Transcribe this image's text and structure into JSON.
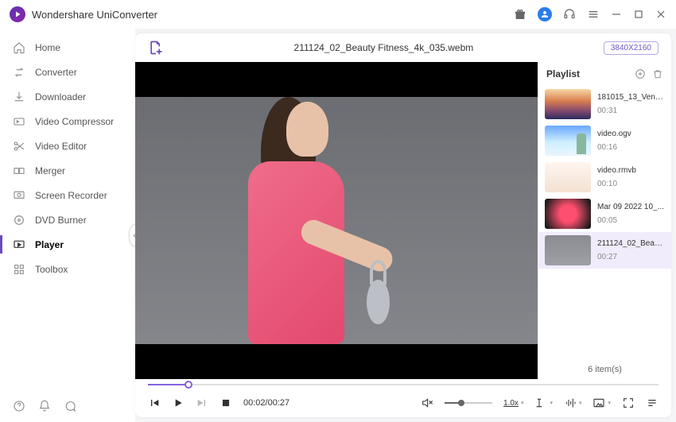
{
  "app": {
    "title": "Wondershare UniConverter"
  },
  "sidebar": {
    "items": [
      {
        "label": "Home"
      },
      {
        "label": "Converter"
      },
      {
        "label": "Downloader"
      },
      {
        "label": "Video Compressor"
      },
      {
        "label": "Video Editor"
      },
      {
        "label": "Merger"
      },
      {
        "label": "Screen Recorder"
      },
      {
        "label": "DVD Burner"
      },
      {
        "label": "Player"
      },
      {
        "label": "Toolbox"
      }
    ]
  },
  "player": {
    "current_title": "211124_02_Beauty Fitness_4k_035.webm",
    "resolution": "3840X2160",
    "time": "00:02/00:27",
    "speed": "1.0x",
    "progress_pct": 8,
    "volume_pct": 35
  },
  "playlist": {
    "title": "Playlist",
    "footer": "6 item(s)",
    "items": [
      {
        "name": "181015_13_Venic...",
        "duration": "00:31",
        "thumb_css": "linear-gradient(180deg,#f7d9a5 0%,#d97d4f 40%,#8a4d6e 70%,#2b2b60 100%)"
      },
      {
        "name": "video.ogv",
        "duration": "00:16",
        "thumb_css": "linear-gradient(180deg,#6aa8ff 0%,#cfefff 55%,#e9f5ff 100%)"
      },
      {
        "name": "video.rmvb",
        "duration": "00:10",
        "thumb_css": "linear-gradient(180deg,#fff6f0 0%,#f3e1d2 100%)"
      },
      {
        "name": "Mar 09 2022 10_...",
        "duration": "00:05",
        "thumb_css": "radial-gradient(circle at 50% 50%, #ff4f6e 0%, #ff4f6e 30%, #1a1a1a 90%)"
      },
      {
        "name": "211124_02_Beau...",
        "duration": "00:27",
        "thumb_css": "linear-gradient(180deg,#8a8c92 0%,#9ea0a6 100%)"
      }
    ]
  }
}
